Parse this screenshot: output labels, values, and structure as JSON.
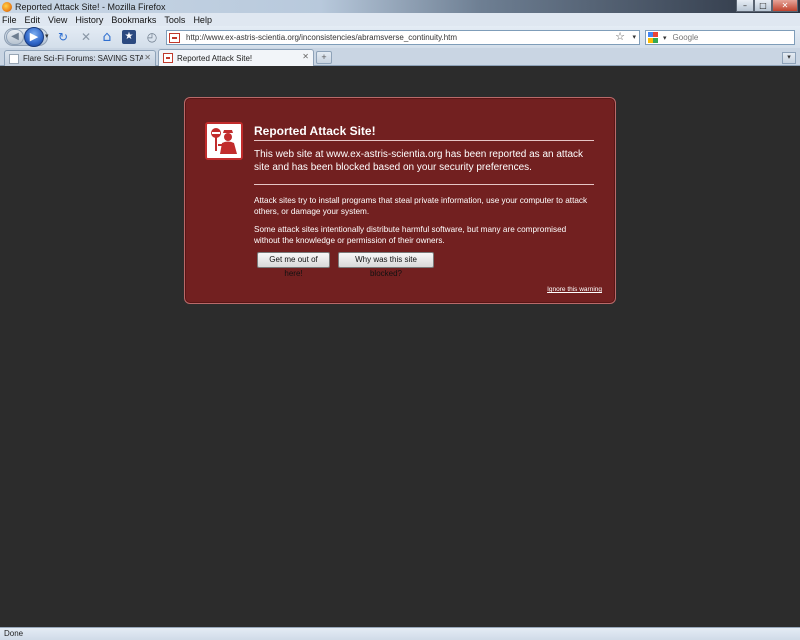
{
  "window": {
    "title": "Reported Attack Site! - Mozilla Firefox",
    "controls": {
      "minimize": "–",
      "maximize": "□",
      "close": "✕"
    }
  },
  "menu": {
    "items": [
      "File",
      "Edit",
      "View",
      "History",
      "Bookmarks",
      "Tools",
      "Help"
    ]
  },
  "toolbar": {
    "back_glyph": "◀",
    "forward_glyph": "▶",
    "dropdown_glyph": "▾",
    "reload_glyph": "↻",
    "stop_glyph": "✕",
    "home_glyph": "⌂",
    "bookmark_glyph": "★",
    "history_glyph": "◴",
    "url": "http://www.ex-astris-scientia.org/inconsistencies/abramsverse_continuity.htm",
    "url_star_glyph": "☆",
    "search_placeholder": "Google"
  },
  "tabs": [
    {
      "label": "Flare Sci-Fi Forums: SAVING STAR T...",
      "close_glyph": "✕",
      "active": false
    },
    {
      "label": "Reported Attack Site!",
      "close_glyph": "✕",
      "active": true
    }
  ],
  "tabbar": {
    "new_tab_glyph": "+",
    "list_glyph": "▾"
  },
  "error_page": {
    "title": "Reported Attack Site!",
    "short_desc": "This web site at www.ex-astris-scientia.org has been reported as an attack site and has been blocked based on your security preferences.",
    "long_desc_1": "Attack sites try to install programs that steal private information, use your computer to attack others, or damage your system.",
    "long_desc_2": "Some attack sites intentionally distribute harmful software, but many are compromised without the knowledge or permission of their owners.",
    "get_me_out_label": "Get me out of here!",
    "why_blocked_label": "Why was this site blocked?",
    "ignore_label": "Ignore this warning"
  },
  "status": {
    "text": "Done"
  },
  "colors": {
    "error_bg": "#722020",
    "content_bg": "#2c2c2c",
    "chrome_bg": "#dfe7f1"
  },
  "icons": {
    "app": "firefox-icon",
    "error": "police-officer-stop-icon"
  }
}
